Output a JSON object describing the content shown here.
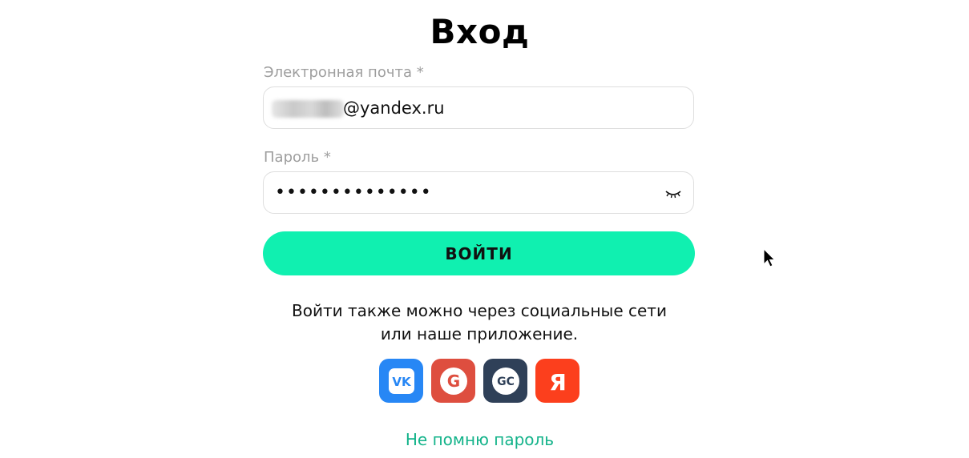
{
  "page": {
    "title": "Вход"
  },
  "form": {
    "email": {
      "label": "Электронная почта *",
      "value_visible": "@yandex.ru"
    },
    "password": {
      "label": "Пароль *",
      "value": "••••••••••••••"
    },
    "submit_label": "ВОЙТИ"
  },
  "social": {
    "text_line1": "Войти также можно через социальные сети",
    "text_line2": "или наше приложение.",
    "buttons": [
      {
        "name": "vk",
        "icon": "vk-icon",
        "color": "#2787f5"
      },
      {
        "name": "google",
        "icon": "google-icon",
        "color": "#de4e3f"
      },
      {
        "name": "gc",
        "icon": "gc-icon",
        "color": "#2f4058"
      },
      {
        "name": "yandex",
        "icon": "yandex-icon",
        "color": "#fc3f1d"
      }
    ]
  },
  "links": {
    "forgot_password": "Не помню пароль"
  },
  "colors": {
    "accent": "#10f0b0",
    "link": "#13b38a",
    "label": "#9e9e9e"
  }
}
